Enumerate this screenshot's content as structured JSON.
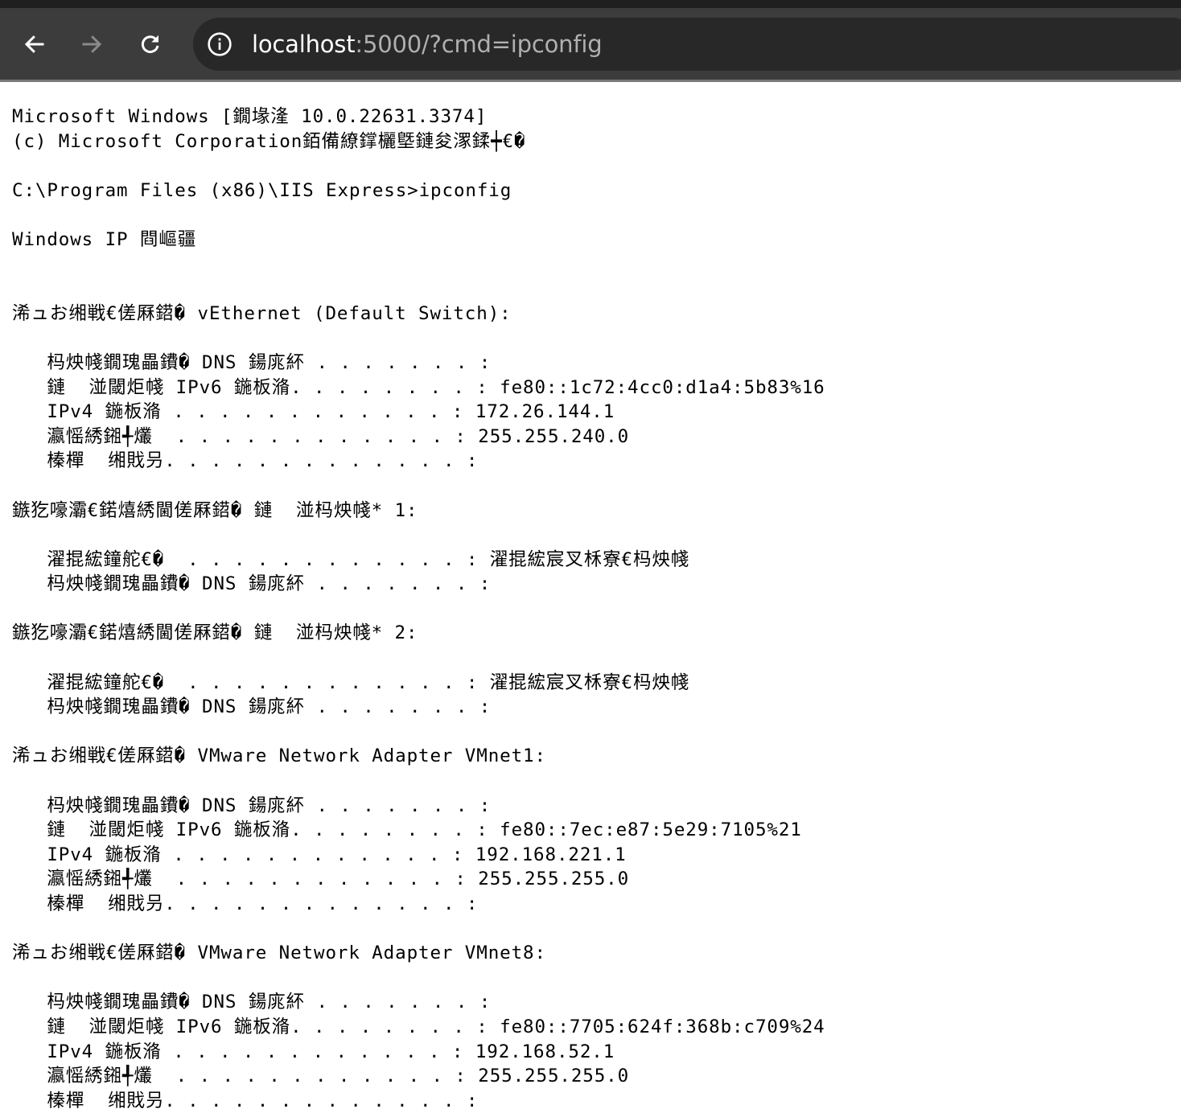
{
  "browser": {
    "nav": {
      "back_icon": "arrow-left-icon",
      "forward_icon": "arrow-right-icon",
      "reload_icon": "reload-icon"
    },
    "address_bar": {
      "site_info_icon": "info-icon",
      "host": "localhost",
      "rest": ":5000/?cmd=ipconfig"
    }
  },
  "output": {
    "lines": [
      "Microsoft Windows [鐗堟湰 10.0.22631.3374]",
      "(c) Microsoft Corporation銆備繚鐣欐墍鏈夋潈鍒┿€�",
      "",
      "C:\\Program Files (x86)\\IIS Express>ipconfig",
      "",
      "Windows IP 閰嶇疆",
      "",
      "",
      "浠ュお缃戦€傞厤鍣� vEthernet (Default Switch):",
      "",
      "   杩炴帴鐗瑰畾鐨� DNS 鍚庣紑 . . . . . . . :",
      "   鏈  湴閾炬帴 IPv6 鍦板潃. . . . . . . . : fe80::1c72:4cc0:d1a4:5b83%16",
      "   IPv4 鍦板潃 . . . . . . . . . . . . : 172.26.144.1",
      "   瀛愮綉鎺╃爜  . . . . . . . . . . . . : 255.255.240.0",
      "   榛樿  缃戝叧. . . . . . . . . . . . . :",
      "",
      "鏃犵嚎灞€鍩熺綉閫傞厤鍣� 鏈  湴杩炴帴* 1:",
      "",
      "   濯掍綋鐘舵€�  . . . . . . . . . . . . : 濯掍綋宸叉柇寮€杩炴帴",
      "   杩炴帴鐗瑰畾鐨� DNS 鍚庣紑 . . . . . . . :",
      "",
      "鏃犵嚎灞€鍩熺綉閫傞厤鍣� 鏈  湴杩炴帴* 2:",
      "",
      "   濯掍綋鐘舵€�  . . . . . . . . . . . . : 濯掍綋宸叉柇寮€杩炴帴",
      "   杩炴帴鐗瑰畾鐨� DNS 鍚庣紑 . . . . . . . :",
      "",
      "浠ュお缃戦€傞厤鍣� VMware Network Adapter VMnet1:",
      "",
      "   杩炴帴鐗瑰畾鐨� DNS 鍚庣紑 . . . . . . . :",
      "   鏈  湴閾炬帴 IPv6 鍦板潃. . . . . . . . : fe80::7ec:e87:5e29:7105%21",
      "   IPv4 鍦板潃 . . . . . . . . . . . . : 192.168.221.1",
      "   瀛愮綉鎺╃爜  . . . . . . . . . . . . : 255.255.255.0",
      "   榛樿  缃戝叧. . . . . . . . . . . . . :",
      "",
      "浠ュお缃戦€傞厤鍣� VMware Network Adapter VMnet8:",
      "",
      "   杩炴帴鐗瑰畾鐨� DNS 鍚庣紑 . . . . . . . :",
      "   鏈  湴閾炬帴 IPv6 鍦板潃. . . . . . . . : fe80::7705:624f:368b:c709%24",
      "   IPv4 鍦板潃 . . . . . . . . . . . . : 192.168.52.1",
      "   瀛愮綉鎺╃爜  . . . . . . . . . . . . : 255.255.255.0",
      "   榛樿  缃戝叧. . . . . . . . . . . . . :"
    ]
  }
}
